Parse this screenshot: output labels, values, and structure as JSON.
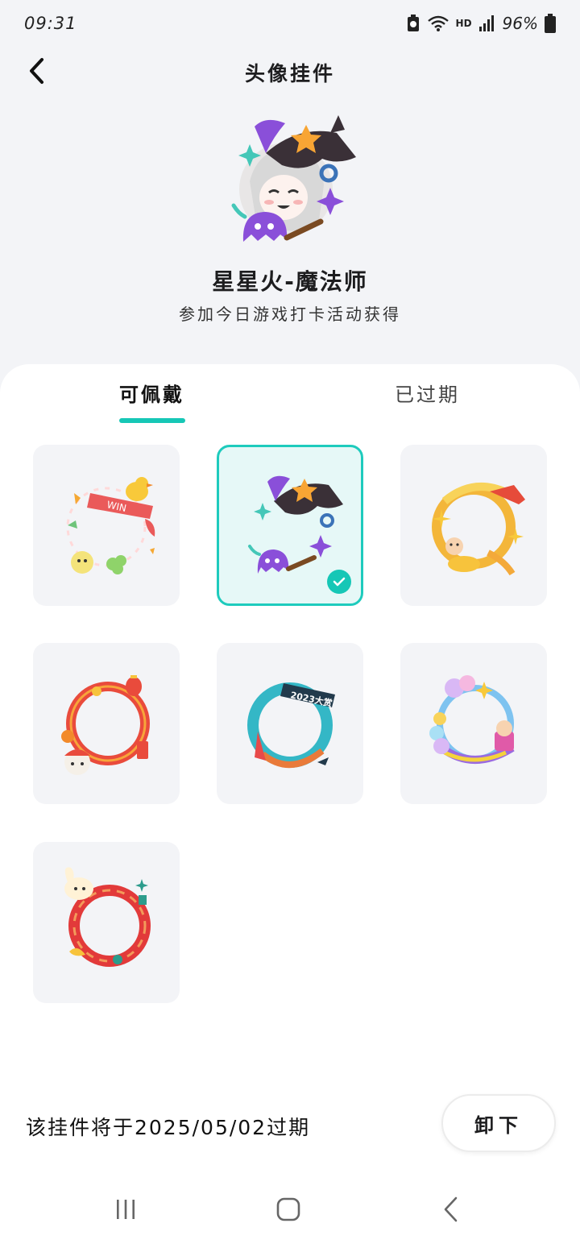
{
  "status_bar": {
    "time": "09:31",
    "network": "HD",
    "battery": "96%"
  },
  "header": {
    "title": "头像挂件",
    "back_icon": "chevron-left-icon"
  },
  "preview": {
    "name": "星星火-魔法师",
    "description": "参加今日游戏打卡活动获得"
  },
  "tabs": [
    {
      "label": "可佩戴",
      "active": true
    },
    {
      "label": "已过期",
      "active": false
    }
  ],
  "frames": [
    {
      "name": "win-duck-frame",
      "selected": false
    },
    {
      "name": "witch-hat-frame",
      "selected": true
    },
    {
      "name": "golden-ribbon-frame",
      "selected": false
    },
    {
      "name": "lion-dance-frame",
      "selected": false
    },
    {
      "name": "2023-frame",
      "selected": false,
      "badge": "2023大赏"
    },
    {
      "name": "pastel-balloon-frame",
      "selected": false
    },
    {
      "name": "rabbit-red-frame",
      "selected": false
    }
  ],
  "footer": {
    "expire_text": "该挂件将于2025/05/02过期",
    "unload_label": "卸下"
  },
  "colors": {
    "accent": "#16c7b6",
    "background": "#f3f4f7"
  }
}
